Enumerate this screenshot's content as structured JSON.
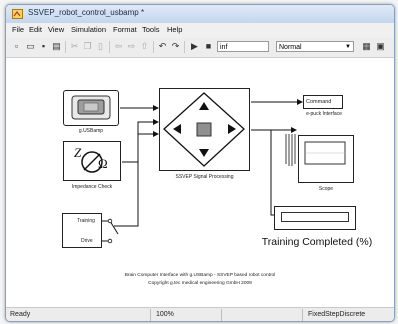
{
  "window": {
    "title": "SSVEP_robot_control_usbamp *"
  },
  "menu": [
    "File",
    "Edit",
    "View",
    "Simulation",
    "Format",
    "Tools",
    "Help"
  ],
  "toolbar": {
    "stop_time": "inf",
    "sim_mode": "Normal"
  },
  "blocks": {
    "usbamp": "g.USBamp",
    "impedance": "Impedance Check",
    "training_in": "Training",
    "drive_in": "Drive",
    "ssvep": "SSVEP Signal Processing",
    "command": "Command",
    "epuck": "e-puck Interface",
    "scope": "Scope",
    "training_completed": "Training Completed (%)"
  },
  "footer": {
    "line1": "Brain Computer Interface with g.USBamp - SSVEP based robot control",
    "line2": "Copyright g.tec medical engineering GmbH 2009"
  },
  "status": {
    "left": "Ready",
    "zoom": "100%",
    "solver": "FixedStepDiscrete"
  },
  "icons": [
    "new-icon",
    "open-icon",
    "save-icon",
    "print-icon",
    "cut-icon",
    "copy-icon",
    "paste-icon",
    "back-icon",
    "forward-icon",
    "up-icon",
    "undo-icon",
    "redo-icon",
    "play-icon",
    "stop-icon",
    "library-icon",
    "model-explorer-icon"
  ]
}
